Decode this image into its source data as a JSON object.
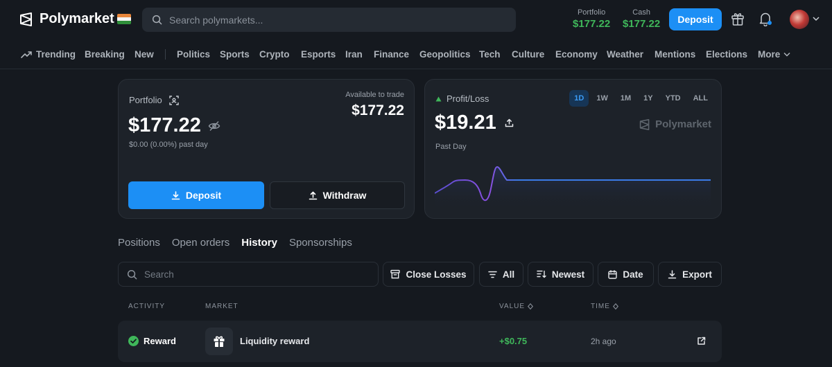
{
  "header": {
    "brand": "Polymarket",
    "search_placeholder": "Search polymarkets...",
    "portfolio_label": "Portfolio",
    "portfolio_value": "$177.22",
    "cash_label": "Cash",
    "cash_value": "$177.22",
    "deposit_label": "Deposit",
    "icons": [
      "gift-icon",
      "bell-icon",
      "avatar",
      "chevron-down-icon"
    ],
    "flag": "india-flag"
  },
  "categories": [
    "Trending",
    "Breaking",
    "New",
    "Politics",
    "Sports",
    "Crypto",
    "Esports",
    "Iran",
    "Finance",
    "Geopolitics",
    "Tech",
    "Culture",
    "Economy",
    "Weather",
    "Mentions",
    "Elections",
    "More"
  ],
  "portfolio": {
    "label": "Portfolio",
    "value": "$177.22",
    "change": "$0.00 (0.00%) past day",
    "available_label": "Available to trade",
    "available_value": "$177.22",
    "deposit_label": "Deposit",
    "withdraw_label": "Withdraw"
  },
  "pnl": {
    "label": "Profit/Loss",
    "value": "$19.21",
    "period_label": "Past Day",
    "ranges": [
      "1D",
      "1W",
      "1M",
      "1Y",
      "YTD",
      "ALL"
    ],
    "active_range": "1D",
    "brand": "Polymarket",
    "accent_color": "#3b7be8"
  },
  "tabs": [
    "Positions",
    "Open orders",
    "History",
    "Sponsorships"
  ],
  "active_tab": "History",
  "filters": {
    "search_placeholder": "Search",
    "close_losses": "Close Losses",
    "all": "All",
    "newest": "Newest",
    "date": "Date",
    "export": "Export"
  },
  "table": {
    "headers": {
      "activity": "ACTIVITY",
      "market": "MARKET",
      "value": "VALUE",
      "time": "TIME"
    },
    "rows": [
      {
        "activity": "Reward",
        "market": "Liquidity reward",
        "value": "+$0.75",
        "time": "2h ago"
      }
    ]
  },
  "colors": {
    "accent": "#1c8ff5",
    "positive": "#3fb75a",
    "background": "#15191f",
    "card": "#1d2229"
  }
}
